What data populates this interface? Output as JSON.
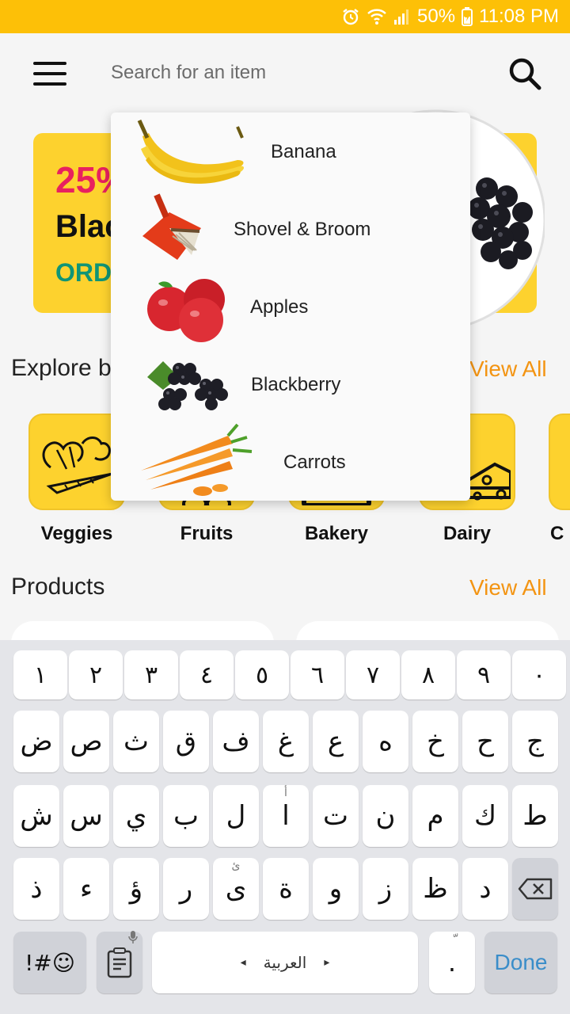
{
  "status_bar": {
    "battery": "50%",
    "time": "11:08 PM"
  },
  "search": {
    "placeholder": "Search for an item"
  },
  "banner": {
    "discount": "25%",
    "headline": "Blac",
    "cta": "ORD"
  },
  "explore": {
    "title": "Explore b",
    "view_all": "View All"
  },
  "categories": [
    {
      "label": "Veggies"
    },
    {
      "label": "Fruits"
    },
    {
      "label": "Bakery"
    },
    {
      "label": "Dairy"
    },
    {
      "label": "C"
    }
  ],
  "products": {
    "title": "Products",
    "view_all": "View All"
  },
  "suggestions": [
    {
      "label": "Banana",
      "icon": "banana-icon"
    },
    {
      "label": "Shovel & Broom",
      "icon": "dustpan-icon"
    },
    {
      "label": "Apples",
      "icon": "apples-icon"
    },
    {
      "label": "Blackberry",
      "icon": "blackberry-icon"
    },
    {
      "label": "Carrots",
      "icon": "carrots-icon"
    }
  ],
  "keyboard": {
    "numbers": [
      "١",
      "٢",
      "٣",
      "٤",
      "٥",
      "٦",
      "٧",
      "٨",
      "٩",
      "٠"
    ],
    "row1": [
      "ض",
      "ص",
      "ث",
      "ق",
      "ف",
      "غ",
      "ع",
      "ه",
      "خ",
      "ح",
      "ج"
    ],
    "row2": [
      "ش",
      "س",
      "ي",
      "ب",
      "ل",
      "ا",
      "ت",
      "ن",
      "م",
      "ك",
      "ط"
    ],
    "row2_hints": [
      "",
      "",
      "",
      "",
      "",
      "أ",
      "",
      "",
      "",
      "",
      ""
    ],
    "row3": [
      "ذ",
      "ء",
      "ؤ",
      "ر",
      "ى",
      "ة",
      "و",
      "ز",
      "ظ",
      "د"
    ],
    "row3_hints": [
      "",
      "",
      "",
      "",
      "ئ",
      "",
      "",
      "",
      "",
      ""
    ],
    "symbols": "!#☺",
    "space": "العربية",
    "punct": ".",
    "punct_hint": "ّ",
    "done": "Done"
  },
  "colors": {
    "status_bar": "#fdc007",
    "accent": "#f39412",
    "banner": "#fdd22e",
    "discount": "#e8215f",
    "cta": "#109576"
  }
}
